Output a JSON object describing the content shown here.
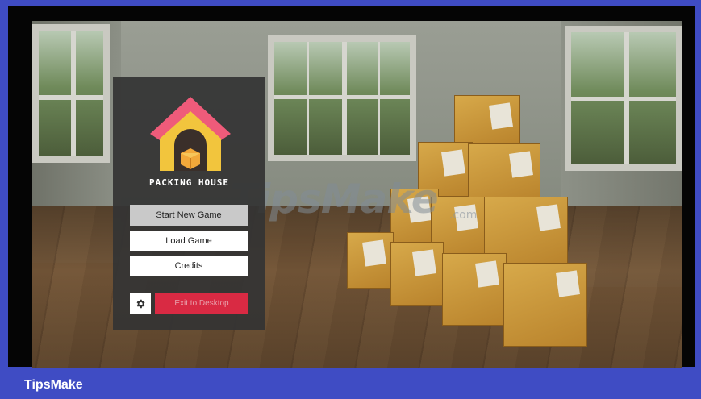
{
  "game": {
    "logo_text": "PACKING HOUSE"
  },
  "menu": {
    "start_new_game": "Start New Game",
    "load_game": "Load Game",
    "credits": "Credits",
    "exit_to_desktop": "Exit to Desktop",
    "settings_icon": "gear-icon"
  },
  "watermark": {
    "main": "TipsMake",
    "suffix": ".com"
  },
  "footer": {
    "label": "TipsMake"
  },
  "colors": {
    "frame": "#3f4cc4",
    "menu_panel": "#343434",
    "exit_button": "#d92a43",
    "logo_roof": "#ef5b7a",
    "logo_house": "#f2c53d"
  }
}
